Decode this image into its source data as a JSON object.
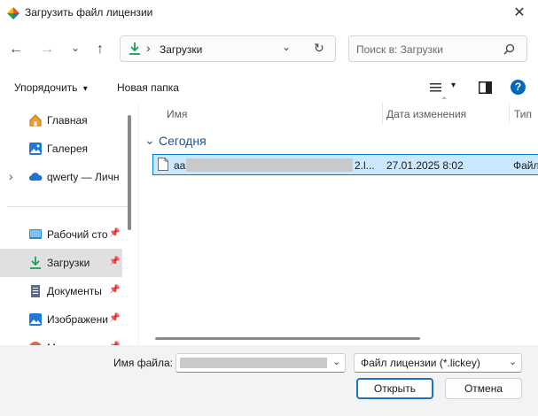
{
  "window": {
    "title": "Загрузить файл лицензии",
    "close_glyph": "✕"
  },
  "nav": {
    "back_glyph": "←",
    "forward_glyph": "→",
    "recent_glyph": "⌄",
    "up_glyph": "↑"
  },
  "address": {
    "separator": "›",
    "folder": "Загрузки",
    "dropdown_glyph": "⌄",
    "refresh_glyph": "↻"
  },
  "search": {
    "placeholder": "Поиск в: Загрузки"
  },
  "toolbar": {
    "organize_label": "Упорядочить",
    "organize_caret": "▾",
    "new_folder_label": "Новая папка",
    "view_caret": "▾",
    "help_glyph": "?"
  },
  "sidebar": {
    "expand_glyph": "›",
    "pin_glyph": "📌",
    "items": [
      {
        "label": "Главная"
      },
      {
        "label": "Галерея"
      },
      {
        "label": "qwerty — Личн"
      },
      {
        "label": "Рабочий сто"
      },
      {
        "label": "Загрузки"
      },
      {
        "label": "Документы"
      },
      {
        "label": "Изображени"
      },
      {
        "label": "М"
      }
    ]
  },
  "columns": {
    "name": "Имя",
    "date": "Дата изменения",
    "type": "Тип",
    "sort_glyph": "⌃"
  },
  "group": {
    "label": "Сегодня",
    "chevron": "⌄"
  },
  "files": [
    {
      "name_start": "аа",
      "name_end": "2.l...",
      "date": "27.01.2025 8:02",
      "type": "Файл"
    }
  ],
  "bottom": {
    "filename_label": "Имя файла:",
    "filename_value": "",
    "dropdown_glyph": "⌄",
    "filter_value": "Файл лицензии (*.lickey)",
    "open_label": "Открыть",
    "cancel_label": "Отмена"
  },
  "colors": {
    "accent": "#0078d4",
    "selection": "#cce8ff",
    "help": "#0067c0"
  }
}
